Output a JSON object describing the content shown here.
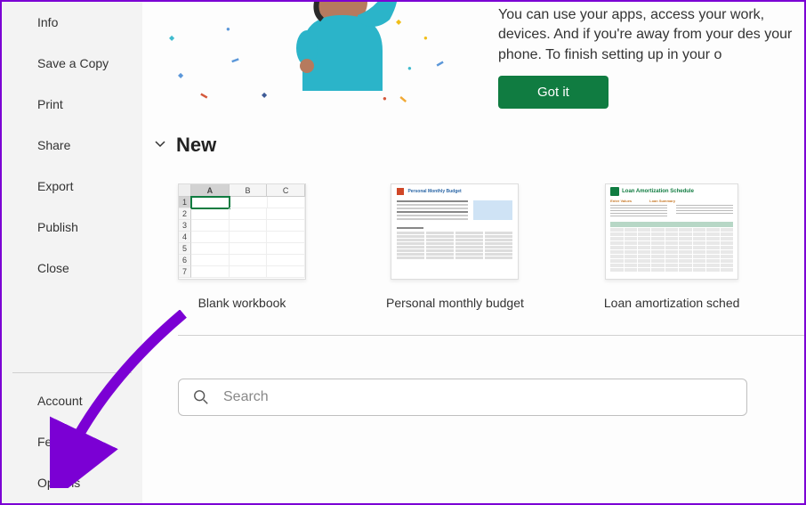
{
  "sidebar": {
    "top_items": [
      "Info",
      "Save a Copy",
      "Print",
      "Share",
      "Export",
      "Publish",
      "Close"
    ],
    "bottom_items": [
      "Account",
      "Feedback",
      "Options"
    ]
  },
  "hero": {
    "text": "You can use your apps, access your work, devices. And if you're away from your des your phone. To finish setting up in your o",
    "button_label": "Got it"
  },
  "section": {
    "title": "New"
  },
  "templates": [
    {
      "label": "Blank workbook",
      "kind": "blank"
    },
    {
      "label": "Personal monthly budget",
      "kind": "budget",
      "thumb_title": "Personal Monthly Budget"
    },
    {
      "label": "Loan amortization sched",
      "kind": "loan",
      "thumb_title": "Loan Amortization Schedule",
      "sub1": "Enter Values",
      "sub2": "Loan Summary"
    }
  ],
  "search": {
    "placeholder": "Search"
  },
  "colors": {
    "accent": "#107c41",
    "annotation": "#7b00d4"
  }
}
